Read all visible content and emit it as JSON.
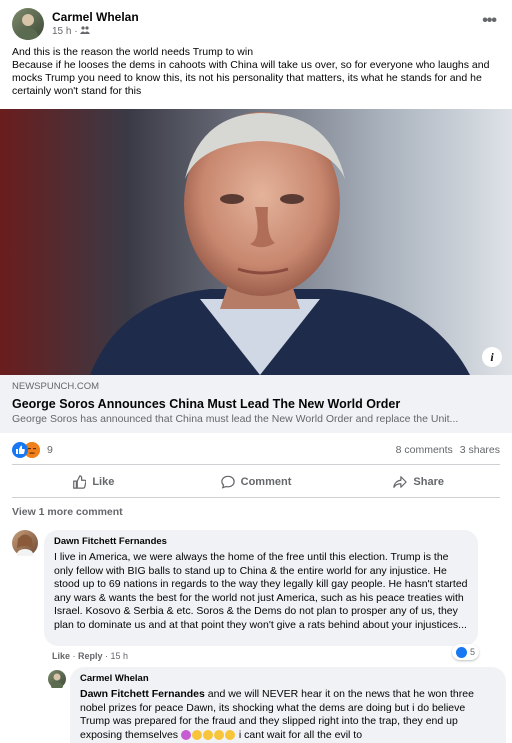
{
  "post": {
    "author": "Carmel Whelan",
    "time": "15 h ·",
    "text_line1": "And this is the reason the world needs Trump to win",
    "text_line2": "Because if he looses the dems in cahoots with China will take us over, so for everyone who laughs and mocks Trump you need to know this, its not his personality that matters, its what he stands for and he certainly won't stand for this"
  },
  "link": {
    "domain": "NEWSPUNCH.COM",
    "title": "George Soros Announces China Must Lead The New World Order",
    "description": "George Soros has announced that China must lead the New World Order and replace the Unit..."
  },
  "stats": {
    "reaction_count": "9",
    "comments": "8 comments",
    "shares": "3 shares"
  },
  "actions": {
    "like": "Like",
    "comment": "Comment",
    "share": "Share"
  },
  "comments": {
    "view_more": "View 1 more comment",
    "c1": {
      "author": "Dawn Fitchett Fernandes",
      "text": "I live in America, we were always the home of the free until this election. Trump is the only fellow with BIG balls to stand up to China & the entire world for any injustice. He stood up to 69 nations in regards to the way they legally kill gay people. He hasn't started any wars & wants the best for the world not just America, such as his peace treaties with Israel. Kosovo & Serbia & etc. Soros & the Dems do not plan to prosper any of us, they plan to dominate us and at that point they won't give a rats behind about your injustices...",
      "like": "Like",
      "reply": "Reply",
      "time": "15 h",
      "likes": "5"
    },
    "c2": {
      "author": "Carmel Whelan",
      "mention": "Dawn Fitchett Fernandes",
      "text": "and we will NEVER hear it on the news that he won three nobel prizes for peace Dawn, its shocking what the dems are doing but i do believe Trump was prepared for the fraud and they slipped right into the trap, they end up exposing themselves",
      "text_after": "i cant wait for all the evil to"
    }
  },
  "colors": {
    "accent": "#1877f2",
    "secondary_text": "#65676b",
    "bubble": "#f0f2f5"
  }
}
